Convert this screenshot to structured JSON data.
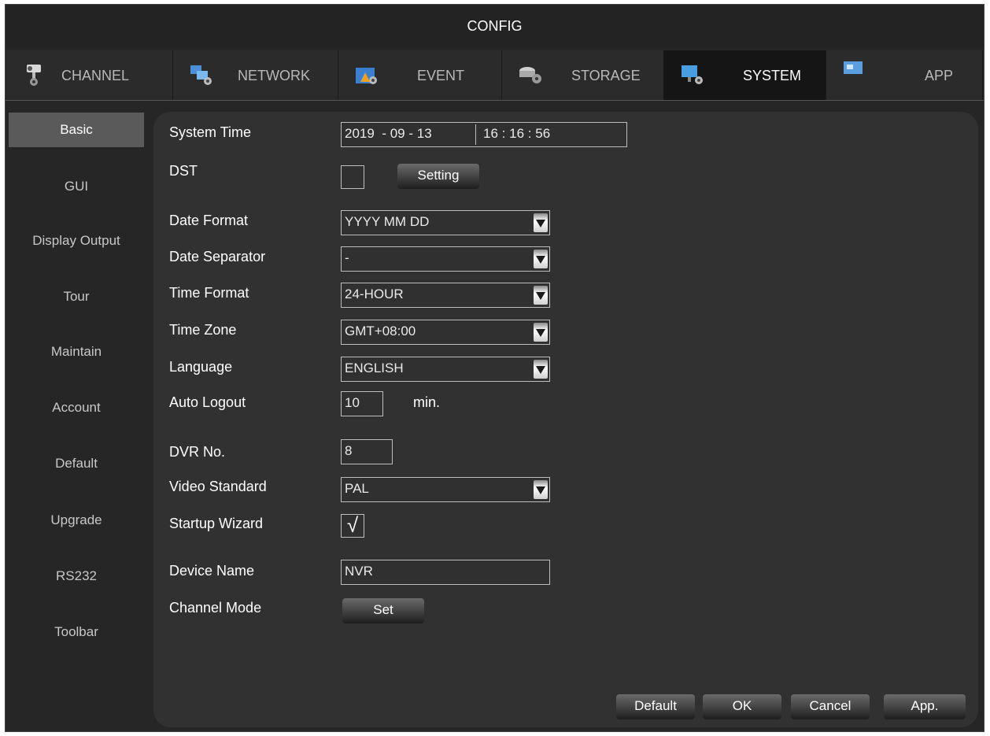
{
  "window": {
    "title": "CONFIG"
  },
  "tabs": [
    {
      "label": "CHANNEL",
      "icon": "camera-icon"
    },
    {
      "label": "NETWORK",
      "icon": "network-icon"
    },
    {
      "label": "EVENT",
      "icon": "event-icon"
    },
    {
      "label": "STORAGE",
      "icon": "storage-icon"
    },
    {
      "label": "SYSTEM",
      "icon": "system-icon",
      "active": true
    },
    {
      "label": "APP",
      "icon": "app-icon"
    }
  ],
  "sidebar": {
    "items": [
      {
        "label": "Basic",
        "active": true
      },
      {
        "label": "GUI"
      },
      {
        "label": "Display Output"
      },
      {
        "label": "Tour"
      },
      {
        "label": "Maintain"
      },
      {
        "label": "Account"
      },
      {
        "label": "Default"
      },
      {
        "label": "Upgrade"
      },
      {
        "label": "RS232"
      },
      {
        "label": "Toolbar"
      }
    ]
  },
  "form": {
    "system_time": {
      "label": "System Time",
      "year": "2019",
      "sep1": "-",
      "month": "09",
      "sep2": "-",
      "day": "13",
      "hour": "16",
      "colon1": ":",
      "minute": "16",
      "colon2": ":",
      "second": "56"
    },
    "dst": {
      "label": "DST",
      "checked": false,
      "button": "Setting"
    },
    "date_format": {
      "label": "Date Format",
      "value": "YYYY MM DD"
    },
    "date_separator": {
      "label": "Date Separator",
      "value": "-"
    },
    "time_format": {
      "label": "Time Format",
      "value": "24-HOUR"
    },
    "time_zone": {
      "label": "Time Zone",
      "value": "GMT+08:00"
    },
    "language": {
      "label": "Language",
      "value": "ENGLISH"
    },
    "auto_logout": {
      "label": "Auto Logout",
      "value": "10",
      "unit": "min."
    },
    "dvr_no": {
      "label": "DVR No.",
      "value": "8"
    },
    "video_standard": {
      "label": "Video Standard",
      "value": "PAL"
    },
    "startup_wizard": {
      "label": "Startup Wizard",
      "checked": true,
      "mark": "√"
    },
    "device_name": {
      "label": "Device Name",
      "value": "NVR"
    },
    "channel_mode": {
      "label": "Channel Mode",
      "button": "Set"
    }
  },
  "footer": {
    "default": "Default",
    "ok": "OK",
    "cancel": "Cancel",
    "apply": "App."
  },
  "colors": {
    "background": "#262626",
    "panel": "#313131",
    "active_tab": "#151515",
    "active_side": "#5a5a5a"
  }
}
